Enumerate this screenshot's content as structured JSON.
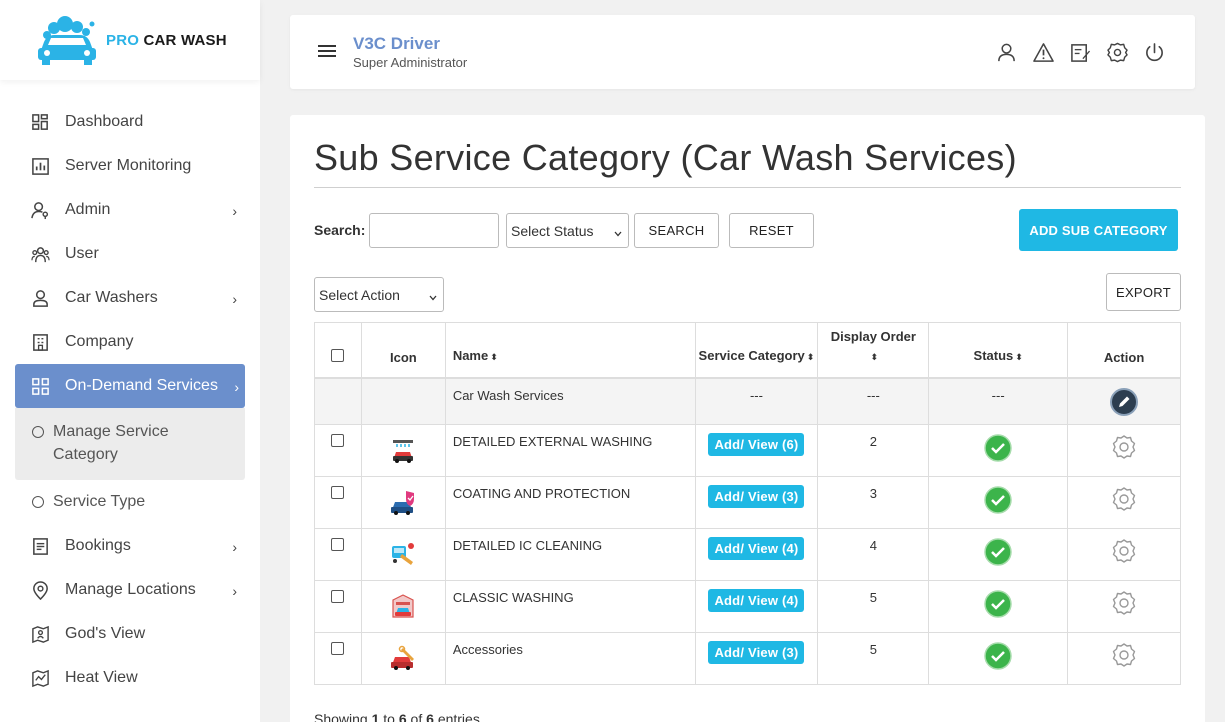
{
  "brand": {
    "pro": "PRO",
    "name": "CAR WASH"
  },
  "sidebar": {
    "items": [
      {
        "label": "Dashboard"
      },
      {
        "label": "Server Monitoring"
      },
      {
        "label": "Admin"
      },
      {
        "label": "User"
      },
      {
        "label": "Car Washers"
      },
      {
        "label": "Company"
      },
      {
        "label": "On-Demand Services"
      },
      {
        "label": "Bookings"
      },
      {
        "label": "Manage Locations"
      },
      {
        "label": "God's View"
      },
      {
        "label": "Heat View"
      }
    ],
    "sub_items": [
      {
        "label": "Manage Service Category"
      },
      {
        "label": "Service Type"
      }
    ],
    "chevron": "›"
  },
  "header": {
    "title": "V3C Driver",
    "subtitle": "Super Administrator"
  },
  "page": {
    "title": "Sub Service Category (Car Wash Services)"
  },
  "toolbar": {
    "search_label": "Search:",
    "search_value": "",
    "status_select": "Select Status",
    "search_btn": "SEARCH",
    "reset_btn": "RESET",
    "add_btn": "ADD SUB CATEGORY",
    "action_select": "Select Action",
    "export_btn": "EXPORT"
  },
  "table": {
    "headers": {
      "icon": "Icon",
      "name": "Name",
      "service_category": "Service Category",
      "display_order": "Display Order",
      "status": "Status",
      "action": "Action"
    },
    "sort_glyph": "⬍",
    "parent_row": {
      "name": "Car Wash Services",
      "service_category": "---",
      "display_order": "---",
      "status": "---"
    },
    "rows": [
      {
        "name": "DETAILED EXTERNAL WASHING",
        "service_btn": "Add/ View (6)",
        "display_order": "2"
      },
      {
        "name": "COATING AND PROTECTION",
        "service_btn": "Add/ View (3)",
        "display_order": "3"
      },
      {
        "name": "DETAILED IC CLEANING",
        "service_btn": "Add/ View (4)",
        "display_order": "4"
      },
      {
        "name": "CLASSIC WASHING",
        "service_btn": "Add/ View (4)",
        "display_order": "5"
      },
      {
        "name": "Accessories",
        "service_btn": "Add/ View (3)",
        "display_order": "5"
      }
    ]
  },
  "footer": {
    "showing": "Showing",
    "from": "1",
    "to_word": "to",
    "to": "6",
    "of_word": "of",
    "total": "6",
    "entries": "entries"
  },
  "colors": {
    "accent": "#6b8fcc",
    "primary": "#1fb8e4",
    "success": "#3cb44b"
  }
}
